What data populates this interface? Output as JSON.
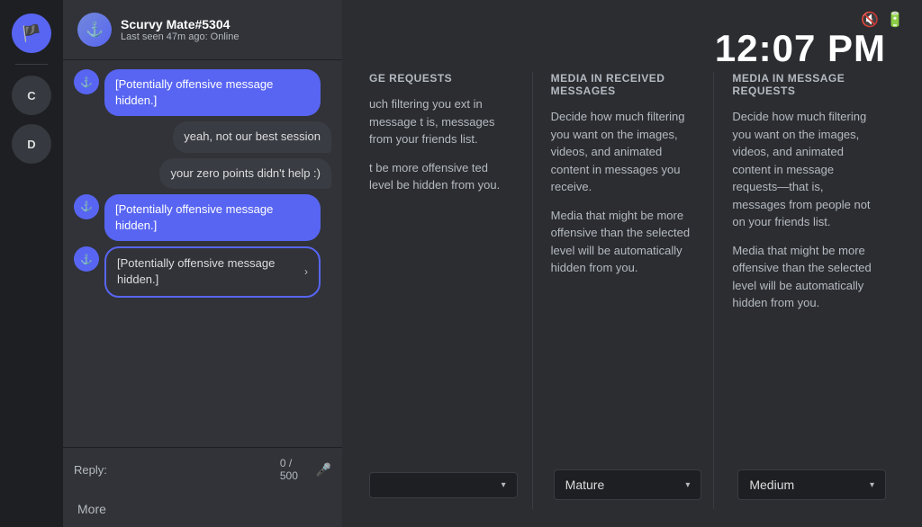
{
  "time": "12:07 PM",
  "status_icons": {
    "mute": "🔇",
    "battery": "🔋"
  },
  "chat": {
    "user_name": "Scurvy Mate#5304",
    "user_status": "Last seen 47m ago: Online",
    "avatar_emoji": "⚓",
    "messages": [
      {
        "id": "msg1",
        "type": "incoming_hidden",
        "text": "[Potentially offensive message hidden.]",
        "active": false
      },
      {
        "id": "msg2",
        "type": "outgoing",
        "text": "yeah, not our best session"
      },
      {
        "id": "msg3",
        "type": "outgoing",
        "text": "your zero points didn't help :)"
      },
      {
        "id": "msg4",
        "type": "incoming_hidden",
        "text": "[Potentially offensive message hidden.]",
        "active": false
      },
      {
        "id": "msg5",
        "type": "incoming_hidden_active",
        "text": "[Potentially offensive message hidden.]",
        "active": true
      }
    ],
    "reply_label": "Reply:",
    "reply_counter": "0 / 500",
    "more_label": "More"
  },
  "settings": {
    "columns": [
      {
        "id": "col1",
        "title": "ge requests",
        "desc1": "uch filtering you ext in message t is, messages from your friends list.",
        "desc2": "t be more offensive ted level be hidden from you.",
        "dropdown_label": ""
      },
      {
        "id": "col2",
        "title": "Media in received messages",
        "desc1": "Decide how much filtering you want on the images, videos, and animated content in messages you receive.",
        "desc2": "Media that might be more offensive than the selected level will be automatically hidden from you.",
        "dropdown_label": "Mature"
      },
      {
        "id": "col3",
        "title": "Media in message requests",
        "desc1": "Decide how much filtering you want on the images, videos, and animated content in message requests—that is, messages from people not on your friends list.",
        "desc2": "Media that might be more offensive than the selected level will be automatically hidden from you.",
        "dropdown_label": "Medium"
      }
    ]
  },
  "sidebar": {
    "server_icons": [
      {
        "id": "main",
        "emoji": "🏴"
      },
      {
        "id": "s1",
        "label": "C"
      },
      {
        "id": "s2",
        "label": "D"
      }
    ]
  }
}
